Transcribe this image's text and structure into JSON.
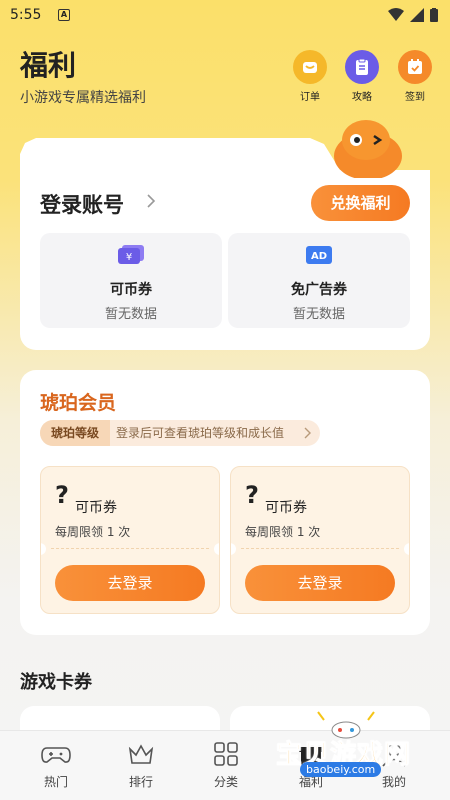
{
  "status_bar": {
    "time": "5:55",
    "indicator": "A"
  },
  "header": {
    "title": "福利",
    "subtitle": "小游戏专属精选福利",
    "actions": [
      {
        "label": "订单",
        "icon": "order-icon",
        "color": "#F5B82A"
      },
      {
        "label": "攻略",
        "icon": "guide-icon",
        "color": "#6B5CE7"
      },
      {
        "label": "签到",
        "icon": "checkin-icon",
        "color": "#F58A2A"
      }
    ]
  },
  "account": {
    "title": "登录账号",
    "exchange_label": "兑换福利",
    "coupons": [
      {
        "name": "可币券",
        "value": "暂无数据",
        "icon": "coin-voucher-icon"
      },
      {
        "name": "免广告券",
        "value": "暂无数据",
        "icon": "ad-free-icon",
        "badge": "AD"
      }
    ]
  },
  "member": {
    "title": "琥珀会员",
    "level_tag": "琥珀等级",
    "level_text": "登录后可查看琥珀等级和成长值",
    "tickets": [
      {
        "mark": "?",
        "name": "可币券",
        "limit": "每周限领 1 次",
        "button": "去登录"
      },
      {
        "mark": "?",
        "name": "可币券",
        "limit": "每周限领 1 次",
        "button": "去登录"
      }
    ]
  },
  "game_cards": {
    "title": "游戏卡券"
  },
  "bottom_nav": {
    "items": [
      {
        "label": "热门",
        "icon": "gamepad-icon"
      },
      {
        "label": "排行",
        "icon": "crown-icon"
      },
      {
        "label": "分类",
        "icon": "grid-icon"
      },
      {
        "label": "福利",
        "icon": "gift-icon"
      },
      {
        "label": "我的",
        "icon": "user-icon"
      }
    ]
  },
  "watermark": {
    "text": "宝贝游戏网",
    "url": "baobeiy.com"
  },
  "colors": {
    "accent": "#F57A22",
    "member": "#D9661E",
    "background_top": "#FBE06A"
  }
}
